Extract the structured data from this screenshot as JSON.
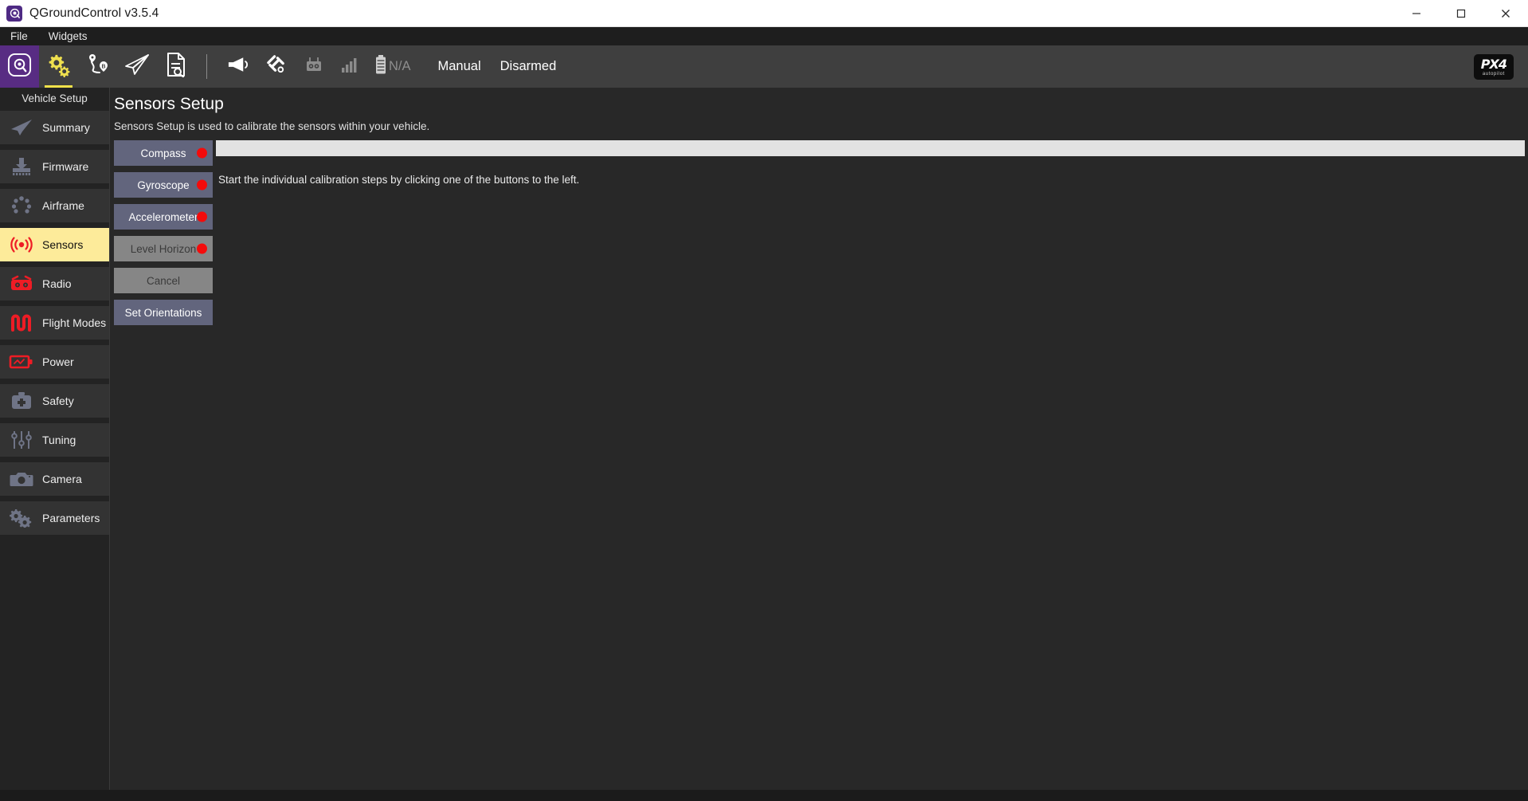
{
  "window": {
    "title": "QGroundControl v3.5.4",
    "app_icon": "qgc-logo-icon",
    "minimize_label": "─",
    "maximize_label": "❐",
    "close_label": "✕"
  },
  "menubar": {
    "items": [
      {
        "label": "File"
      },
      {
        "label": "Widgets"
      }
    ]
  },
  "toolbar": {
    "nav_buttons": [
      {
        "name": "qgc-logo-button",
        "icon": "qgc-logo-icon",
        "state": "active"
      },
      {
        "name": "vehicle-setup-button",
        "icon": "gears-icon",
        "state": "selected"
      },
      {
        "name": "plan-button",
        "icon": "waypoints-icon",
        "state": "normal"
      },
      {
        "name": "fly-button",
        "icon": "paper-plane-icon",
        "state": "normal"
      },
      {
        "name": "analyze-button",
        "icon": "document-search-icon",
        "state": "normal"
      }
    ],
    "status_icons": [
      {
        "name": "messages-indicator",
        "icon": "megaphone-icon"
      },
      {
        "name": "gps-indicator",
        "icon": "satellite-icon"
      },
      {
        "name": "rc-indicator",
        "icon": "rc-controller-icon"
      },
      {
        "name": "telemetry-indicator",
        "icon": "signal-bars-icon"
      },
      {
        "name": "battery-indicator",
        "icon": "battery-icon"
      }
    ],
    "battery_value": "N/A",
    "flight_mode": "Manual",
    "armed_state": "Disarmed",
    "brand": {
      "main": "PX4",
      "sub": "autopilot"
    }
  },
  "sidebar": {
    "title": "Vehicle Setup",
    "items": [
      {
        "label": "Summary",
        "icon": "paper-plane-icon",
        "icon_color": "#6f7486",
        "selected": false
      },
      {
        "label": "Firmware",
        "icon": "download-chip-icon",
        "icon_color": "#6f7486",
        "selected": false
      },
      {
        "label": "Airframe",
        "icon": "airframe-dots-icon",
        "icon_color": "#6f7486",
        "selected": false
      },
      {
        "label": "Sensors",
        "icon": "sensors-waves-icon",
        "icon_color": "#ee1c25",
        "selected": true
      },
      {
        "label": "Radio",
        "icon": "radio-icon",
        "icon_color": "#ee1c25",
        "selected": false
      },
      {
        "label": "Flight Modes",
        "icon": "flight-modes-icon",
        "icon_color": "#ee1c25",
        "selected": false
      },
      {
        "label": "Power",
        "icon": "power-battery-icon",
        "icon_color": "#ee1c25",
        "selected": false
      },
      {
        "label": "Safety",
        "icon": "first-aid-icon",
        "icon_color": "#6f7486",
        "selected": false
      },
      {
        "label": "Tuning",
        "icon": "sliders-icon",
        "icon_color": "#6f7486",
        "selected": false
      },
      {
        "label": "Camera",
        "icon": "camera-icon",
        "icon_color": "#6f7486",
        "selected": false
      },
      {
        "label": "Parameters",
        "icon": "gears-icon",
        "icon_color": "#6f7486",
        "selected": false
      }
    ]
  },
  "main": {
    "title": "Sensors Setup",
    "subtitle": "Sensors Setup is used to calibrate the sensors within your vehicle.",
    "calibration_buttons": [
      {
        "label": "Compass",
        "enabled": true,
        "indicator": "#f40b0b"
      },
      {
        "label": "Gyroscope",
        "enabled": true,
        "indicator": "#f40b0b"
      },
      {
        "label": "Accelerometer",
        "enabled": true,
        "indicator": "#f40b0b"
      },
      {
        "label": "Level Horizon",
        "enabled": false,
        "indicator": "#f40b0b"
      },
      {
        "label": "Cancel",
        "enabled": false,
        "indicator": null
      },
      {
        "label": "Set Orientations",
        "enabled": true,
        "indicator": null
      }
    ],
    "progress": {
      "value": 0,
      "track_color": "#e2e2e2"
    },
    "instruction": "Start the individual calibration steps by clicking one of the buttons to the left."
  }
}
